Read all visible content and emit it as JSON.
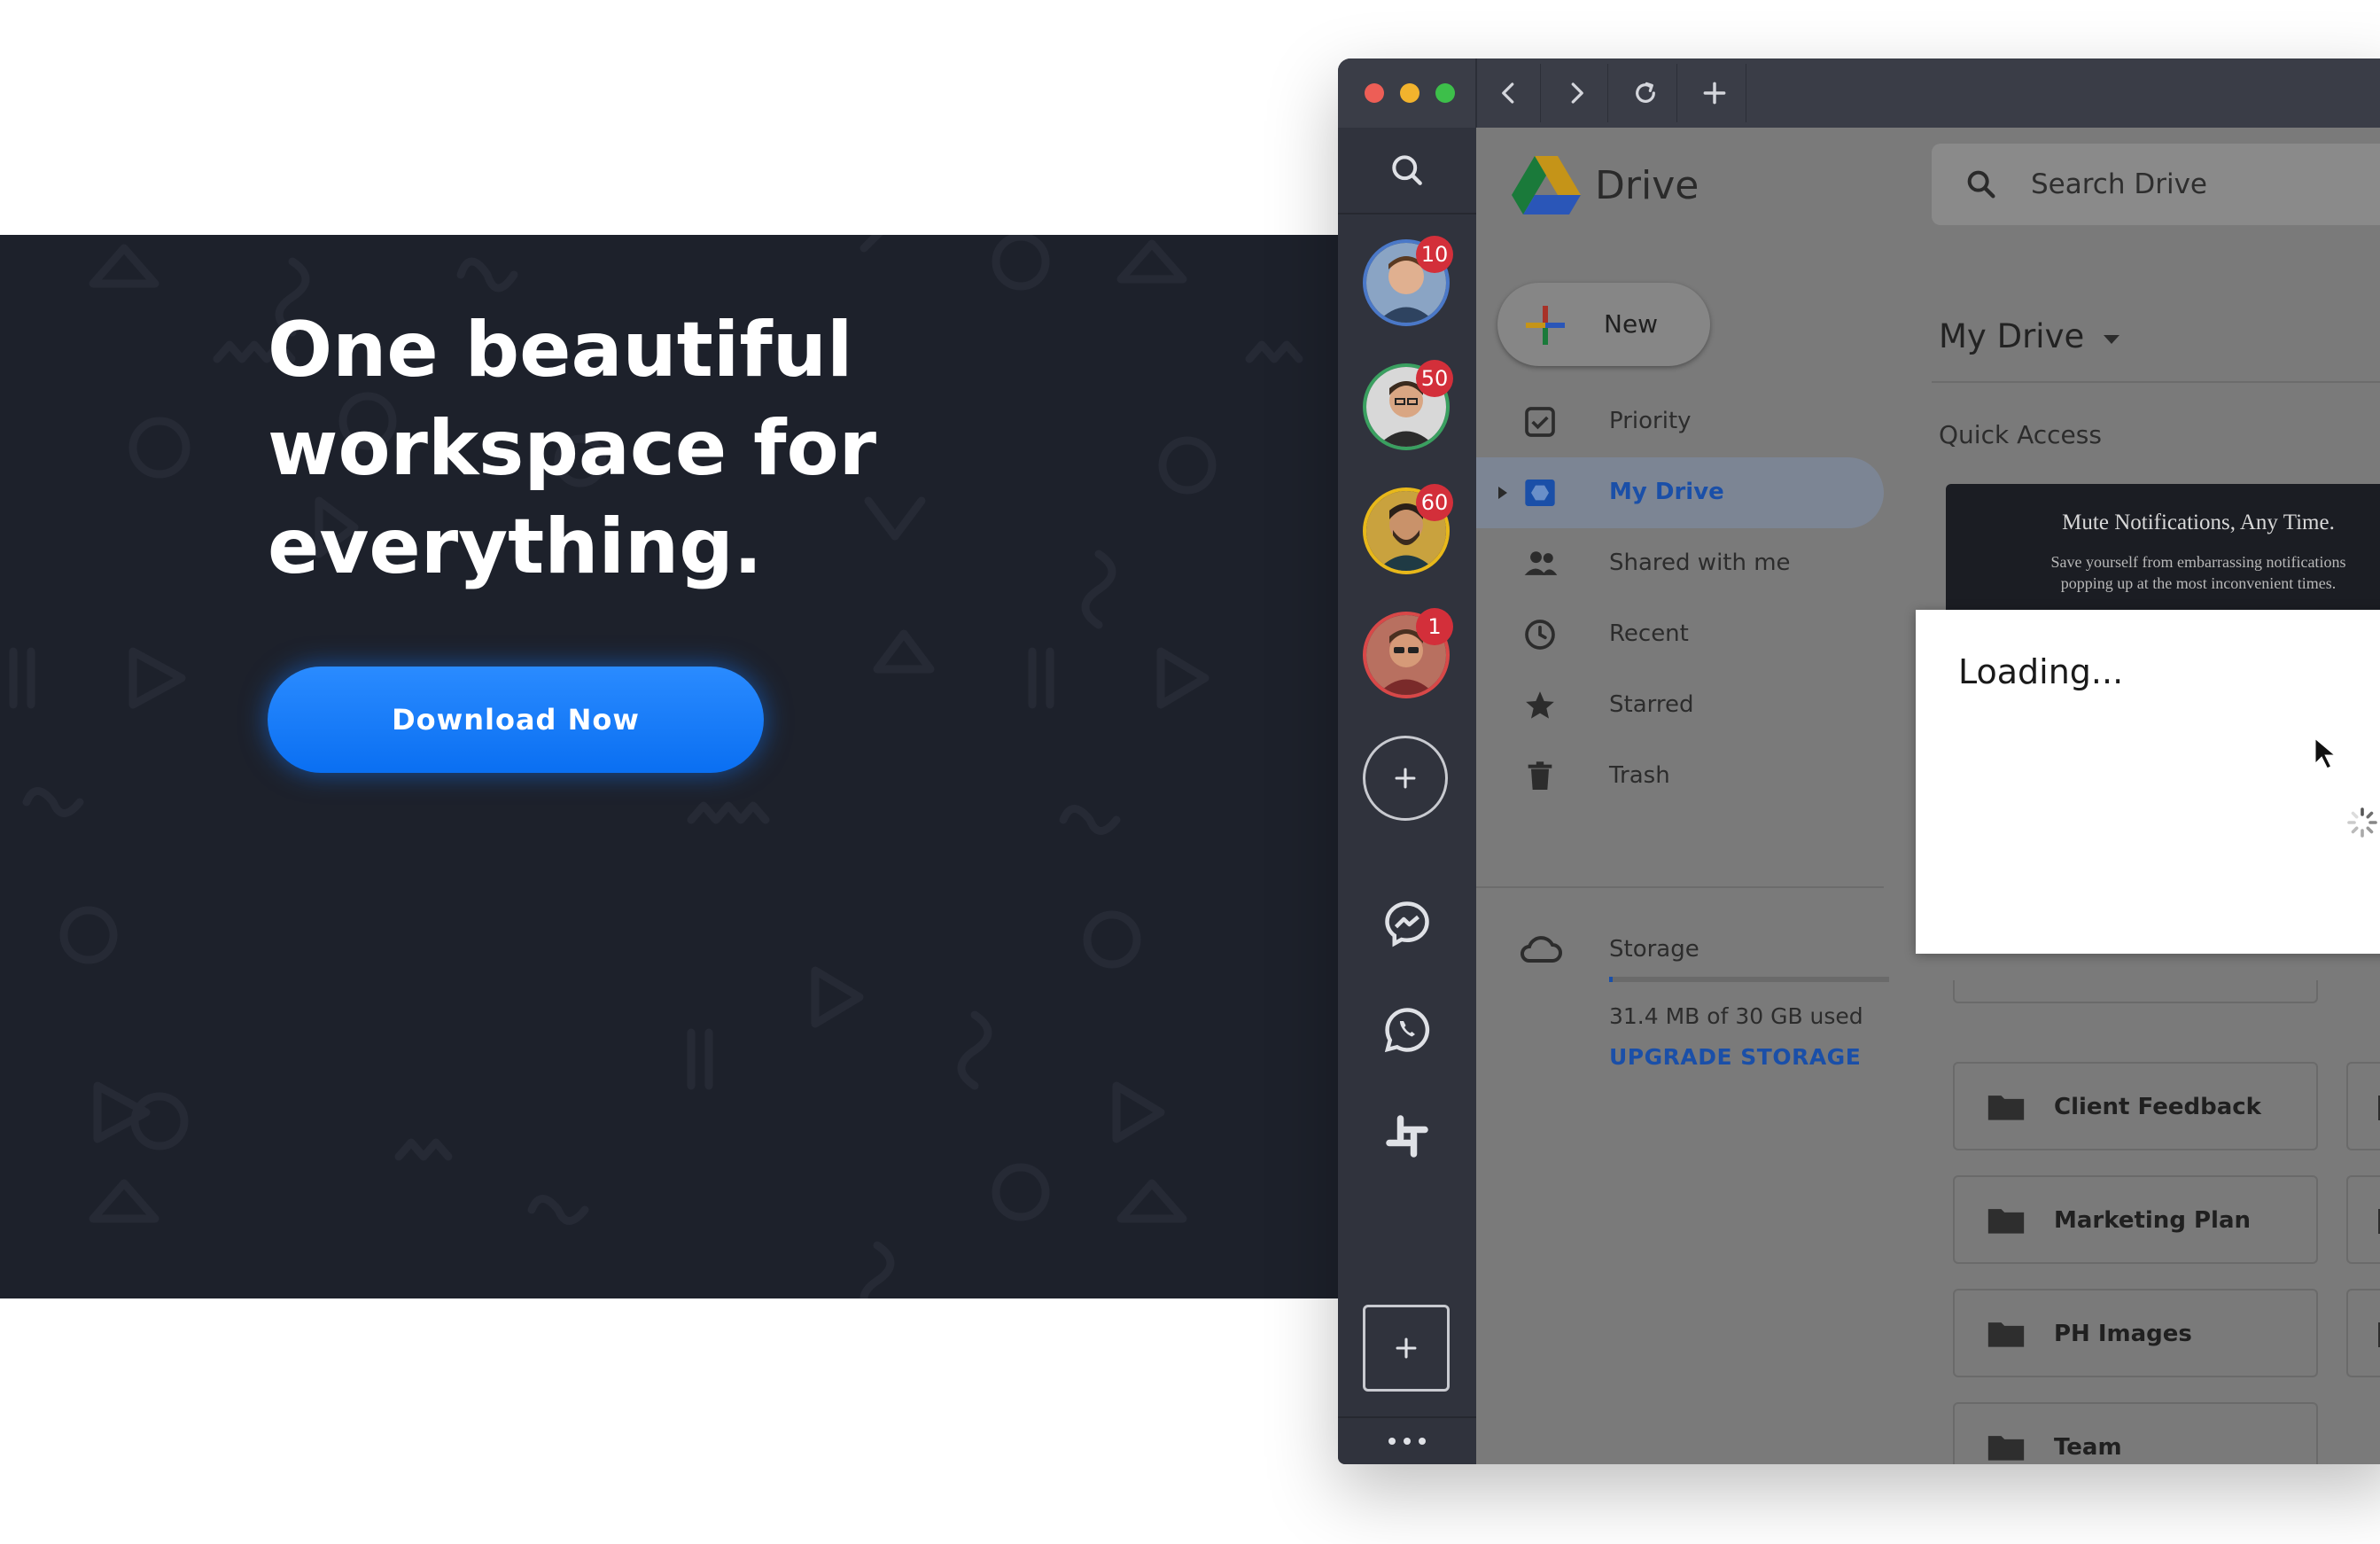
{
  "hero": {
    "headline_lines": [
      "One beautiful",
      "workspace for",
      "everything."
    ],
    "cta_label": "Download Now"
  },
  "colors": {
    "hero_bg": "#1d212b",
    "cta": "#1a7dfc",
    "badge": "#d32f3a",
    "drive_link": "#1a4fa8"
  },
  "browser": {
    "toolbar_icons": [
      "chevron-left-icon",
      "chevron-right-icon",
      "reload-icon",
      "plus-icon"
    ]
  },
  "rail": {
    "accounts": [
      {
        "badge": "10",
        "ring": "#4a78c8"
      },
      {
        "badge": "50",
        "ring": "#3aa060"
      },
      {
        "badge": "60",
        "ring": "#e8b81a"
      },
      {
        "badge": "1",
        "ring": "#d84848"
      }
    ],
    "apps": [
      "messenger-icon",
      "whatsapp-icon",
      "slack-icon"
    ]
  },
  "drive": {
    "app_name": "Drive",
    "search_placeholder": "Search Drive",
    "new_label": "New",
    "nav": [
      {
        "label": "Priority",
        "icon": "priority-icon"
      },
      {
        "label": "My Drive",
        "icon": "my-drive-icon",
        "active": true
      },
      {
        "label": "Shared with me",
        "icon": "shared-icon"
      },
      {
        "label": "Recent",
        "icon": "clock-icon"
      },
      {
        "label": "Starred",
        "icon": "star-icon"
      },
      {
        "label": "Trash",
        "icon": "trash-icon"
      }
    ],
    "storage_label": "Storage",
    "storage_used": "31.4 MB of 30 GB used",
    "storage_used_fraction": 0.001,
    "upgrade_label": "UPGRADE STORAGE",
    "breadcrumb": "My Drive",
    "quick_access": "Quick Access",
    "promo_title": "Mute Notifications, Any Time.",
    "promo_text_lines": [
      "Save yourself from embarrassing notifications",
      "popping up at the most inconvenient times."
    ],
    "folders": [
      "Client Feedback",
      "Marketing Plan",
      "PH Images",
      "Team"
    ]
  },
  "loading": {
    "text": "Loading..."
  }
}
